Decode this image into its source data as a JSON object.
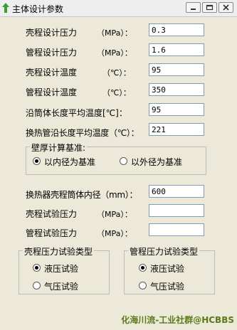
{
  "window": {
    "title": "主体设计参数",
    "accent": "#3a9e2f"
  },
  "fields": [
    {
      "label": "壳程设计压力",
      "unit": "（MPa）：",
      "value": "0.3"
    },
    {
      "label": "管程设计压力",
      "unit": "（MPa）：",
      "value": "1.6"
    },
    {
      "label": "壳程设计温度",
      "unit": "（℃）：",
      "value": "95"
    },
    {
      "label": "管程设计温度",
      "unit": "（℃）：",
      "value": "350"
    },
    {
      "label": "沿筒体长度平均温度[℃]：",
      "unit": "",
      "value": "95"
    },
    {
      "label": "换热管沿长度平均温度（℃）：",
      "unit": "",
      "value": "221"
    }
  ],
  "wall_group": {
    "title": "壁厚计算基准:",
    "options": [
      "以内径为基准",
      "以外径为基准"
    ],
    "selected": 0
  },
  "lower_fields": [
    {
      "label": "换热器壳程筒体内径（mm）：",
      "value": "600"
    },
    {
      "label": "壳程试验压力",
      "unit": "（MPa）：",
      "value": ""
    },
    {
      "label": "管程试验压力",
      "unit": "（MPa）：",
      "value": ""
    }
  ],
  "shell_test_group": {
    "title": "壳程压力试验类型",
    "options": [
      "液压试验",
      "气压试验"
    ],
    "selected": 0
  },
  "tube_test_group": {
    "title": "管程压力试验类型",
    "options": [
      "液压试验",
      "气压试验"
    ],
    "selected": 0
  },
  "watermark": "化海川流-工业社群@HCBBS"
}
